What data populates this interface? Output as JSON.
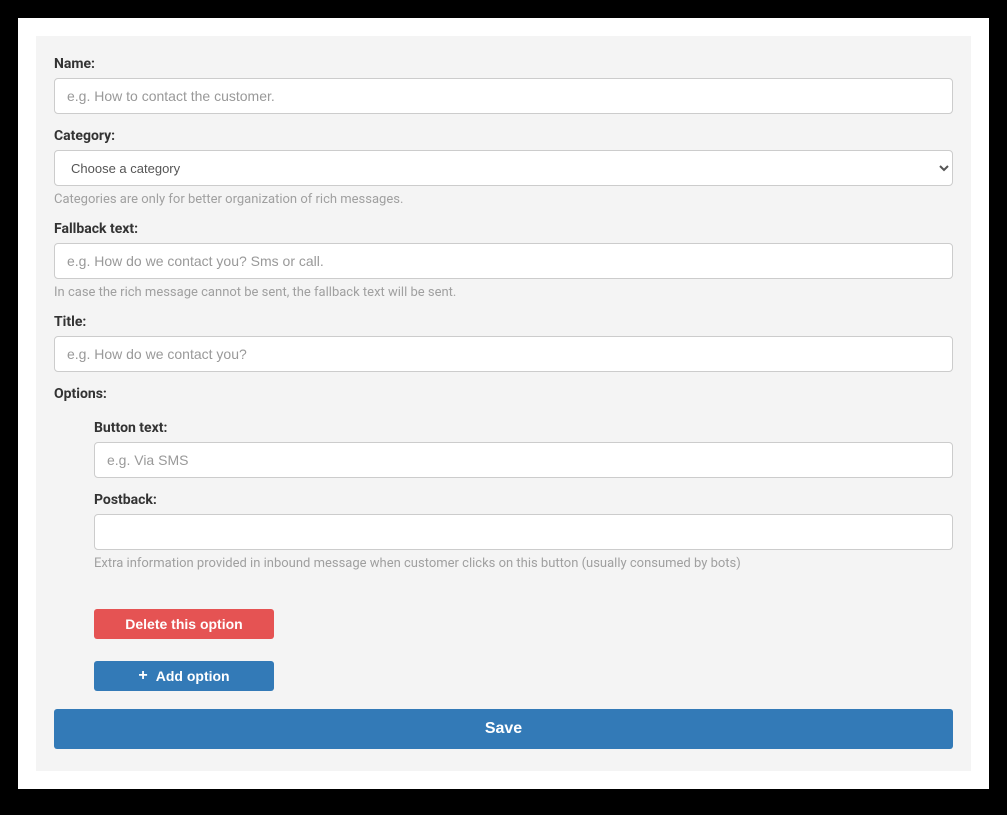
{
  "form": {
    "name": {
      "label": "Name:",
      "placeholder": "e.g. How to contact the customer."
    },
    "category": {
      "label": "Category:",
      "placeholder": "Choose a category",
      "help": "Categories are only for better organization of rich messages."
    },
    "fallback": {
      "label": "Fallback text:",
      "placeholder": "e.g. How do we contact you? Sms or call.",
      "help": "In case the rich message cannot be sent, the fallback text will be sent."
    },
    "title": {
      "label": "Title:",
      "placeholder": "e.g. How do we contact you?"
    },
    "options": {
      "label": "Options:",
      "buttonText": {
        "label": "Button text:",
        "placeholder": "e.g. Via SMS"
      },
      "postback": {
        "label": "Postback:",
        "help": "Extra information provided in inbound message when customer clicks on this button (usually consumed by bots)"
      },
      "deleteLabel": "Delete this option",
      "addLabel": "Add option"
    },
    "saveLabel": "Save"
  }
}
